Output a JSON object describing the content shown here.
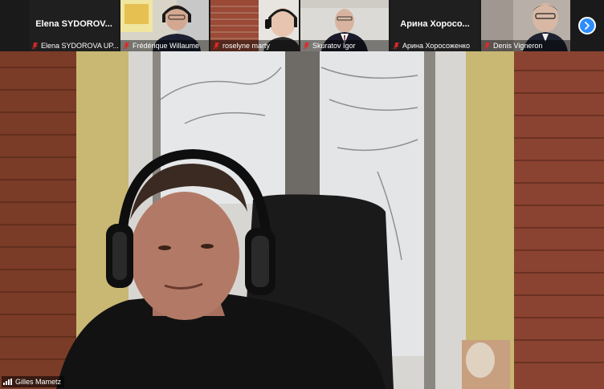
{
  "strip": {
    "participants": [
      {
        "display_name": "Elena  SYDOROV...",
        "label": "Elena SYDOROVA UP...",
        "video": false,
        "muted": true
      },
      {
        "label": "Frédérique Willaume",
        "video": true,
        "muted": true
      },
      {
        "label": "roselyne marty",
        "video": true,
        "muted": true
      },
      {
        "label": "Skuratov Igor",
        "video": true,
        "muted": true
      },
      {
        "display_name": "Арина  Хоросо...",
        "label": "Арина Хоросоженко",
        "video": false,
        "muted": true
      },
      {
        "label": "Denis Vigneron",
        "video": true,
        "muted": true
      }
    ],
    "next_icon": "chevron-right-icon",
    "accent_color": "#2d8cff",
    "muted_color": "#e02828"
  },
  "main": {
    "speaker_label": "Gilles Mametz",
    "signal_icon": "signal-bars-icon"
  }
}
